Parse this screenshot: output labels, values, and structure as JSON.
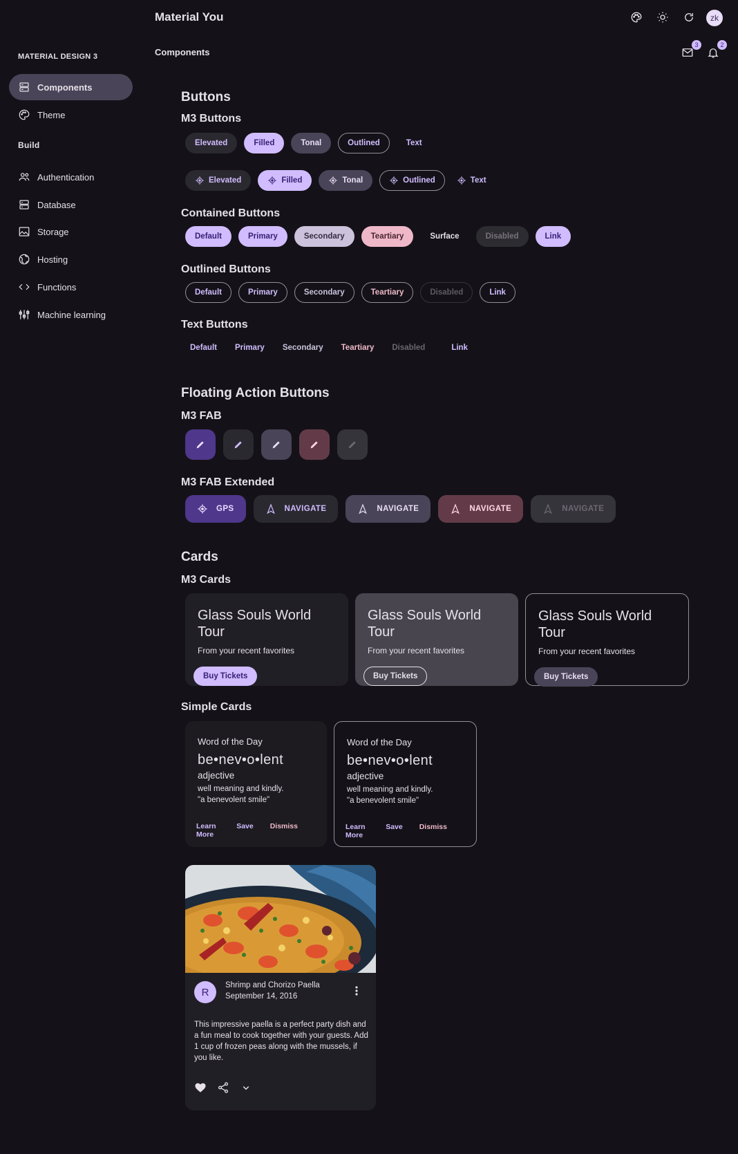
{
  "header": {
    "app_title": "Material You",
    "page_title": "Components",
    "avatar_initials": "zk",
    "mail_badge": "3",
    "bell_badge": "2"
  },
  "sidebar": {
    "section_title": "MATERIAL DESIGN 3",
    "items": [
      {
        "label": "Components",
        "icon": "components-icon",
        "active": true
      },
      {
        "label": "Theme",
        "icon": "palette-icon"
      }
    ],
    "build_title": "Build",
    "build_items": [
      {
        "label": "Authentication",
        "icon": "people-icon"
      },
      {
        "label": "Database",
        "icon": "database-icon"
      },
      {
        "label": "Storage",
        "icon": "image-icon"
      },
      {
        "label": "Hosting",
        "icon": "globe-icon"
      },
      {
        "label": "Functions",
        "icon": "code-icon"
      },
      {
        "label": "Machine learning",
        "icon": "sliders-icon"
      }
    ]
  },
  "buttons": {
    "title": "Buttons",
    "m3_title": "M3 Buttons",
    "m3": [
      "Elevated",
      "Filled",
      "Tonal",
      "Outlined",
      "Text"
    ],
    "contained_title": "Contained Buttons",
    "contained": [
      "Default",
      "Primary",
      "Secondary",
      "Teartiary",
      "Surface",
      "Disabled",
      "Link"
    ],
    "outlined_title": "Outlined Buttons",
    "outlined": [
      "Default",
      "Primary",
      "Secondary",
      "Teartiary",
      "Disabled",
      "Link"
    ],
    "text_title": "Text Buttons",
    "text": [
      "Default",
      "Primary",
      "Secondary",
      "Teartiary",
      "Disabled",
      "Link"
    ]
  },
  "fab": {
    "title": "Floating Action Buttons",
    "m3_title": "M3 FAB",
    "extended_title": "M3 FAB Extended",
    "extended": [
      "GPS",
      "NAVIGATE",
      "NAVIGATE",
      "NAVIGATE",
      "NAVIGATE"
    ]
  },
  "cards": {
    "title": "Cards",
    "m3_title": "M3 Cards",
    "m3": [
      {
        "title": "Glass Souls World Tour",
        "subtitle": "From your recent favorites",
        "button": "Buy Tickets"
      },
      {
        "title": "Glass Souls World Tour",
        "subtitle": "From your recent favorites",
        "button": "Buy Tickets"
      },
      {
        "title": "Glass Souls World Tour",
        "subtitle": "From your recent favorites",
        "button": "Buy Tickets"
      }
    ],
    "simple_title": "Simple Cards",
    "word": {
      "label": "Word of the Day",
      "word": "be•nev•o•lent",
      "type": "adjective",
      "def1": "well meaning and kindly.",
      "def2": "\"a benevolent smile\"",
      "learn": "Learn More",
      "save": "Save",
      "dismiss": "Dismiss"
    },
    "media": {
      "avatar": "R",
      "title": "Shrimp and Chorizo Paella",
      "date": "September 14, 2016",
      "body": "This impressive paella is a perfect party dish and a fun meal to cook together with your guests. Add 1 cup of frozen peas along with the mussels, if you like."
    }
  },
  "colors": {
    "background": "#141218",
    "primary": "#d0bcff",
    "on_primary": "#381e72",
    "secondary_container": "#4a4458",
    "tertiary": "#efb8c8"
  }
}
